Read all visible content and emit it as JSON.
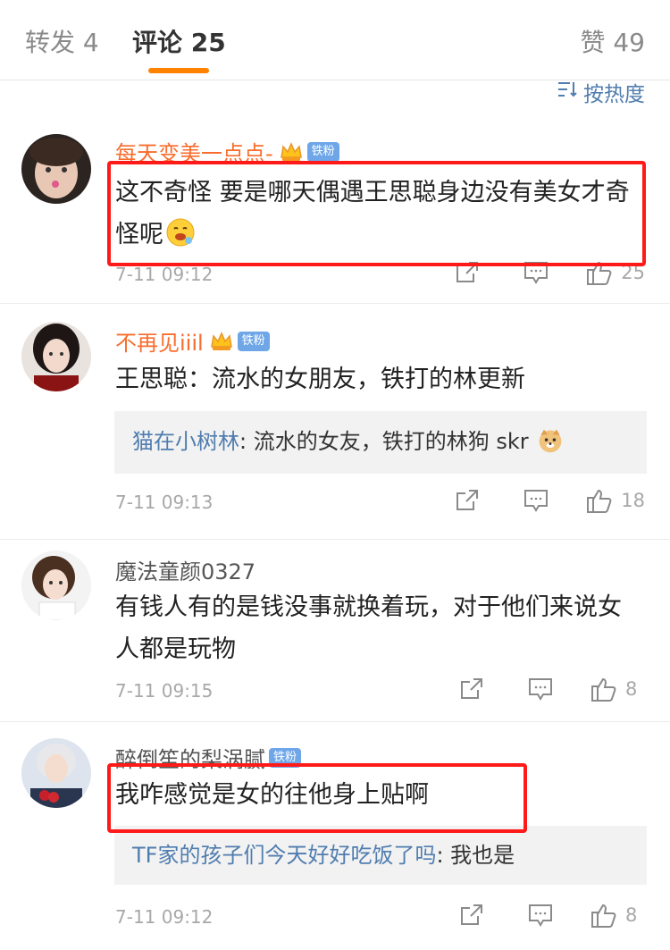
{
  "tabs": {
    "repost": "转发 4",
    "comments": "评论 25",
    "likes": "赞 49"
  },
  "sort": {
    "label": "按热度",
    "icon": "sort-icon"
  },
  "comments": [
    {
      "username": "每天变美一点点-",
      "badge": "铁粉",
      "text": "这不奇怪 要是哪天偶遇王思聪身边没有美女才奇怪呢",
      "emoji": "face-with-drool-emoji",
      "time": "7-11 09:12",
      "likes": "25"
    },
    {
      "username": "不再见iiil",
      "badge": "铁粉",
      "text": "王思聪：流水的女朋友，铁打的林更新",
      "reply_name": "猫在小树林",
      "reply_text": ": 流水的女友，铁打的林狗 skr",
      "reply_emoji": "doge-emoji",
      "time": "7-11 09:13",
      "likes": "18"
    },
    {
      "username": "魔法童颜0327",
      "text": "有钱人有的是钱没事就换着玩，对于他们来说女人都是玩物",
      "time": "7-11 09:15",
      "likes": "8"
    },
    {
      "username": "醉倒笙的梨涡腻",
      "badge": "铁粉",
      "text": "我咋感觉是女的往他身上贴啊",
      "reply_name": "TF家的孩子们今天好好吃饭了吗",
      "reply_text": ": 我也是",
      "time": "7-11 09:12",
      "likes": "8"
    }
  ],
  "colors": {
    "accent": "#ff8200",
    "vip_name": "#f86d2d",
    "link": "#507daf",
    "highlight": "#ff1a1a"
  }
}
